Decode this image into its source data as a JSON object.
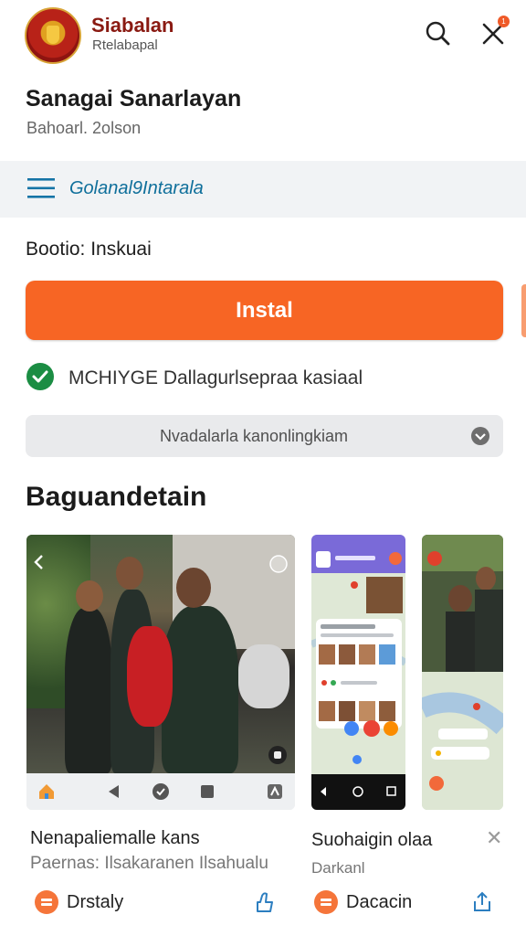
{
  "header": {
    "app_name": "Siabalan",
    "app_sub": "Rtelabapal",
    "badge": "1"
  },
  "title": "Sanagai Sanarlayan",
  "subtitle": "Bahoarl. 2olson",
  "menu_link": "Golanal9Intarala",
  "status": "Bootio: Inskuai",
  "install_label": "Instal",
  "verified": "MCHIYGE Dallagurlsepraa kasiaal",
  "dropdown": "Nvadalarla kanonlingkiam",
  "section_title": "Baguandetain",
  "screenshots": [
    {
      "caption": "Nenapaliemalle kans",
      "sub": "Paernas: Ilsakaranen Ilsahualu"
    },
    {
      "caption": "Suohaigin olaa",
      "sub": "Darkanl"
    }
  ],
  "footer": [
    {
      "label": "Drstaly"
    },
    {
      "label": "Dacacin"
    }
  ],
  "colors": {
    "accent": "#f76524",
    "brand": "#8a1a12",
    "verified": "#1b8d43",
    "link": "#0f6f9b"
  }
}
